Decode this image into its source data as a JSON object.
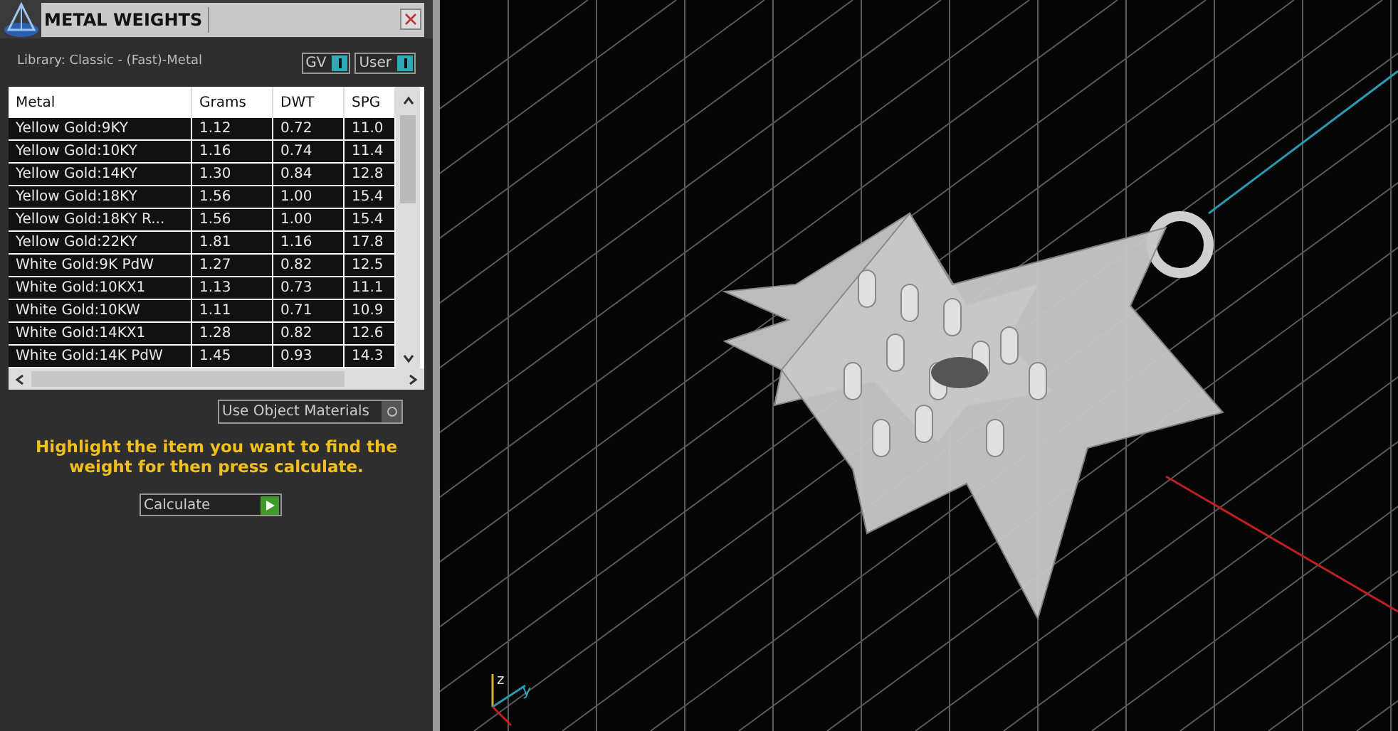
{
  "panel": {
    "title": "METAL WEIGHTS",
    "library": "Library: Classic - (Fast)-Metal",
    "toggles": [
      {
        "label": "GV",
        "on": true
      },
      {
        "label": "User",
        "on": true
      }
    ],
    "table": {
      "columns": [
        "Metal",
        "Grams",
        "DWT",
        "SPG"
      ],
      "rows": [
        {
          "cells": [
            "Yellow Gold:9KY",
            "1.12",
            "0.72",
            "11.0"
          ]
        },
        {
          "cells": [
            "Yellow Gold:10KY",
            "1.16",
            "0.74",
            "11.4"
          ]
        },
        {
          "cells": [
            "Yellow Gold:14KY",
            "1.30",
            "0.84",
            "12.8"
          ]
        },
        {
          "cells": [
            "Yellow Gold:18KY",
            "1.56",
            "1.00",
            "15.4"
          ]
        },
        {
          "cells": [
            "Yellow Gold:18KY R...",
            "1.56",
            "1.00",
            "15.4"
          ]
        },
        {
          "cells": [
            "Yellow Gold:22KY",
            "1.81",
            "1.16",
            "17.8"
          ]
        },
        {
          "cells": [
            "White Gold:9K PdW",
            "1.27",
            "0.82",
            "12.5"
          ]
        },
        {
          "cells": [
            "White Gold:10KX1",
            "1.13",
            "0.73",
            "11.1"
          ]
        },
        {
          "cells": [
            "White Gold:10KW",
            "1.11",
            "0.71",
            "10.9"
          ]
        },
        {
          "cells": [
            "White Gold:14KX1",
            "1.28",
            "0.82",
            "12.6"
          ]
        },
        {
          "cells": [
            "White Gold:14K PdW",
            "1.45",
            "0.93",
            "14.3"
          ]
        }
      ]
    },
    "use_object_materials": {
      "label": "Use Object Materials",
      "on": false
    },
    "hint": "Highlight the item you want to find the weight for then press calculate.",
    "calculate_button": "Calculate"
  },
  "viewport": {
    "axis_labels": [
      "z",
      "y"
    ]
  }
}
